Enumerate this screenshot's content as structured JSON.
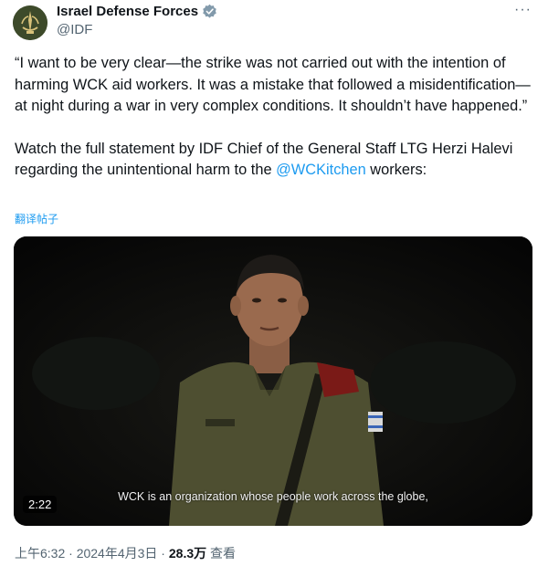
{
  "author": {
    "name": "Israel Defense Forces",
    "handle": "@IDF",
    "verified_icon": "verified-badge-icon",
    "avatar_icon": "idf-emblem-icon"
  },
  "more_label": "···",
  "tweet": {
    "quote": "“I want to be very clear—the strike was not carried out with the intention of harming WCK aid workers. It was a mistake that followed a misidentification—at night during a war in very complex conditions. It shouldn’t have happened.”",
    "statement_before": "Watch the full statement by IDF Chief of the General Staff LTG Herzi Halevi regarding the unintentional harm to the ",
    "mention": "@WCKitchen",
    "statement_after": " workers:",
    "translate_label": "翻译帖子"
  },
  "video": {
    "duration": "2:22",
    "subtitle": "WCK is an organization whose people work across the globe,"
  },
  "meta": {
    "time": "上午6:32",
    "separator": " · ",
    "date": "2024年4月3日",
    "views": "28.3万",
    "views_label": " 查看"
  },
  "colors": {
    "link": "#1d9bf0",
    "secondary_text": "#536471",
    "verified": "#829aab"
  }
}
